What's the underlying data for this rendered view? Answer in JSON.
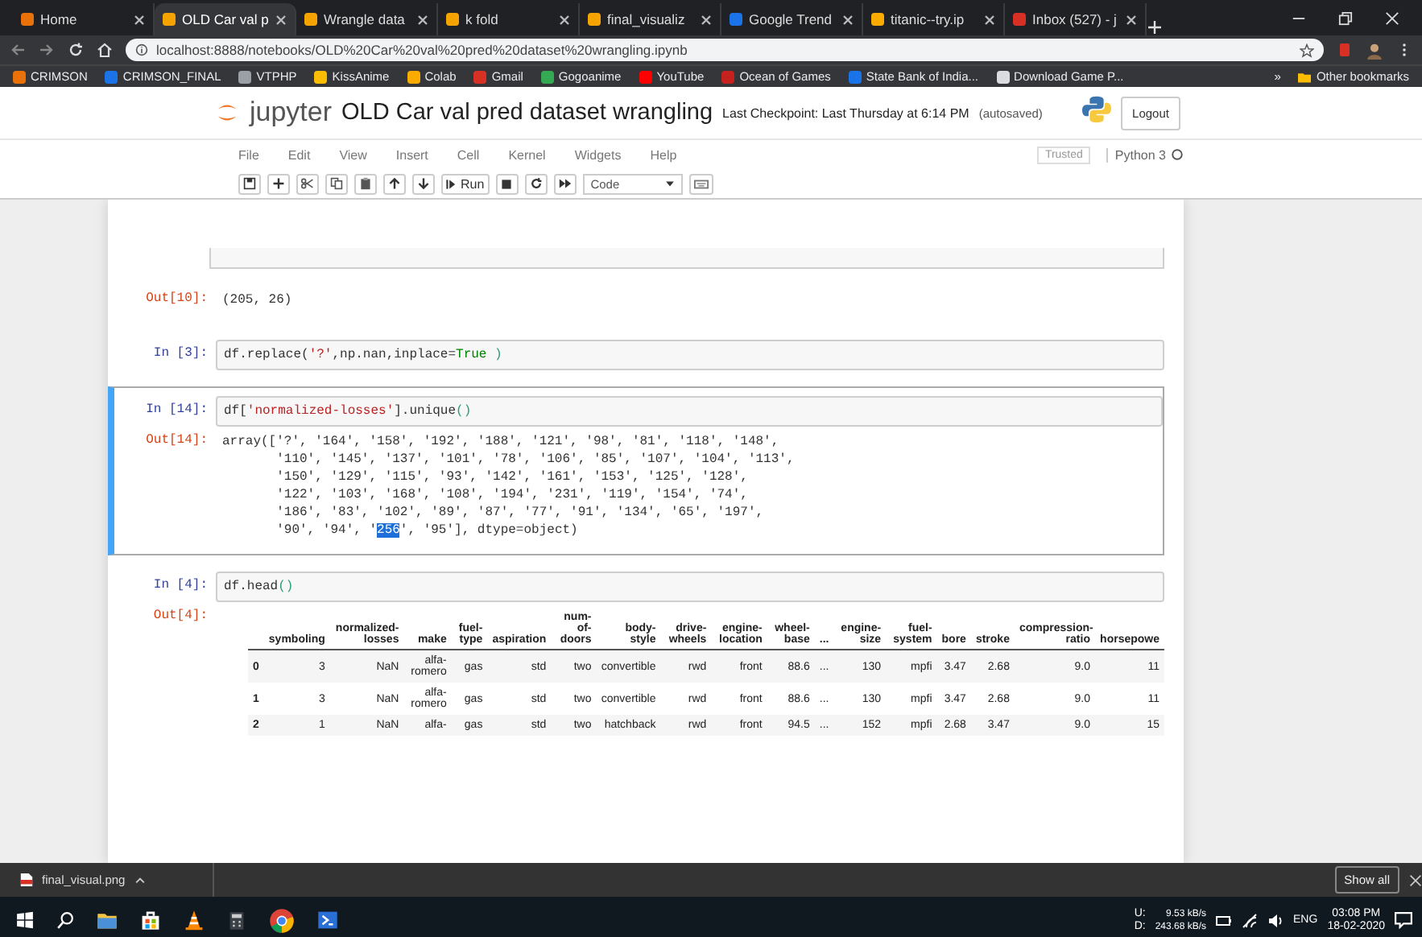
{
  "browser": {
    "tabs": [
      {
        "title": "Home",
        "selected": false,
        "color": "#e8710a"
      },
      {
        "title": "OLD Car val p",
        "selected": true,
        "color": "#f4a300"
      },
      {
        "title": "Wrangle data",
        "selected": false,
        "color": "#f4a300"
      },
      {
        "title": "k fold",
        "selected": false,
        "color": "#f4a300"
      },
      {
        "title": "final_visualiz",
        "selected": false,
        "color": "#f4a300"
      },
      {
        "title": "Google Trend",
        "selected": false,
        "color": "#1a73e8"
      },
      {
        "title": "titanic--try.ip",
        "selected": false,
        "color": "#f9ab00"
      },
      {
        "title": "Inbox (527) - j",
        "selected": false,
        "color": "#d93025"
      }
    ],
    "address": "localhost:8888/notebooks/OLD%20Car%20val%20pred%20dataset%20wrangling.ipynb",
    "bookmarks": [
      {
        "label": "CRIMSON",
        "color": "#e8710a"
      },
      {
        "label": "CRIMSON_FINAL",
        "color": "#1a73e8"
      },
      {
        "label": "VTPHP",
        "color": "#9aa0a6"
      },
      {
        "label": "KissAnime",
        "color": "#fbbc04"
      },
      {
        "label": "Colab",
        "color": "#f9ab00"
      },
      {
        "label": "Gmail",
        "color": "#d93025"
      },
      {
        "label": "Gogoanime",
        "color": "#34a853"
      },
      {
        "label": "YouTube",
        "color": "#ff0000"
      },
      {
        "label": "Ocean of Games",
        "color": "#c5221f"
      },
      {
        "label": "State Bank of India...",
        "color": "#1a73e8"
      },
      {
        "label": "Download Game P...",
        "color": "#dadce0"
      }
    ],
    "overflow": "»",
    "other_bookmarks": "Other bookmarks"
  },
  "jupyter": {
    "logo": "jupyter",
    "title": "OLD Car val pred dataset wrangling",
    "checkpoint": "Last Checkpoint: Last Thursday at 6:14 PM",
    "autosaved": "(autosaved)",
    "logout": "Logout",
    "menu": [
      "File",
      "Edit",
      "View",
      "Insert",
      "Cell",
      "Kernel",
      "Widgets",
      "Help"
    ],
    "trusted": "Trusted",
    "kernel": "Python 3",
    "run": "Run",
    "cell_type": "Code"
  },
  "cells": [
    {
      "selected": false,
      "output": {
        "prompt": "Out[10]:",
        "lines": [
          [
            {
              "t": "(205, 26)",
              "kind": "plain"
            }
          ]
        ]
      }
    },
    {
      "selected": false,
      "prompt": "In [3]:",
      "code": [
        [
          {
            "t": "df.replace(",
            "kind": "plain"
          },
          {
            "t": "'?'",
            "kind": "string"
          },
          {
            "t": ",np.nan,inplace=",
            "kind": "plain"
          },
          {
            "t": "True",
            "kind": "keyword"
          },
          {
            "t": " )",
            "kind": "paren"
          }
        ]
      ]
    },
    {
      "selected": true,
      "prompt": "In [14]:",
      "code": [
        [
          {
            "t": "df[",
            "kind": "plain"
          },
          {
            "t": "'normalized-losses'",
            "kind": "string"
          },
          {
            "t": "].unique",
            "kind": "plain"
          },
          {
            "t": "()",
            "kind": "paren"
          }
        ]
      ],
      "output": {
        "prompt": "Out[14]:",
        "lines": [
          [
            {
              "t": "array(['?', '164', '158', '192', '188', '121', '98', '81', '118', '148',",
              "kind": "plain"
            }
          ],
          [
            {
              "t": "       '110', '145', '137', '101', '78', '106', '85', '107', '104', '113',",
              "kind": "plain"
            }
          ],
          [
            {
              "t": "       '150', '129', '115', '93', '142', '161', '153', '125', '128',",
              "kind": "plain"
            }
          ],
          [
            {
              "t": "       '122', '103', '168', '108', '194', '231', '119', '154', '74',",
              "kind": "plain"
            }
          ],
          [
            {
              "t": "       '186', '83', '102', '89', '87', '77', '91', '134', '65', '197',",
              "kind": "plain"
            }
          ],
          [
            {
              "t": "       '90', '94', '",
              "kind": "plain"
            },
            {
              "t": "256",
              "kind": "highlight"
            },
            {
              "t": "', '95'], dtype=object)",
              "kind": "plain"
            }
          ]
        ]
      }
    },
    {
      "selected": false,
      "prompt": "In [4]:",
      "code": [
        [
          {
            "t": "df.head",
            "kind": "plain"
          },
          {
            "t": "()",
            "kind": "paren"
          }
        ]
      ],
      "output": {
        "prompt": "Out[4]:",
        "table": {
          "columns": [
            "",
            "symboling",
            "normalized-losses",
            "make",
            "fuel-type",
            "aspiration",
            "num-of-doors",
            "body-style",
            "drive-wheels",
            "engine-location",
            "wheel-base",
            "...",
            "engine-size",
            "fuel-system",
            "bore",
            "stroke",
            "compression-ratio",
            "horsepowe"
          ],
          "rows": [
            [
              "0",
              "3",
              "NaN",
              "alfa-romero",
              "gas",
              "std",
              "two",
              "convertible",
              "rwd",
              "front",
              "88.6",
              "...",
              "130",
              "mpfi",
              "3.47",
              "2.68",
              "9.0",
              "11"
            ],
            [
              "1",
              "3",
              "NaN",
              "alfa-romero",
              "gas",
              "std",
              "two",
              "convertible",
              "rwd",
              "front",
              "88.6",
              "...",
              "130",
              "mpfi",
              "3.47",
              "2.68",
              "9.0",
              "11"
            ],
            [
              "2",
              "1",
              "NaN",
              "alfa-",
              "gas",
              "std",
              "two",
              "hatchback",
              "rwd",
              "front",
              "94.5",
              "...",
              "152",
              "mpfi",
              "2.68",
              "3.47",
              "9.0",
              "15"
            ]
          ]
        }
      }
    }
  ],
  "download": {
    "file": "final_visual.png",
    "show_all": "Show all"
  },
  "taskbar": {
    "upload_label": "U:",
    "upload": "9.53 kB/s",
    "download_label": "D:",
    "download": "243.68 kB/s",
    "language": "ENG",
    "time": "03:08 PM",
    "date": "18-02-2020"
  }
}
